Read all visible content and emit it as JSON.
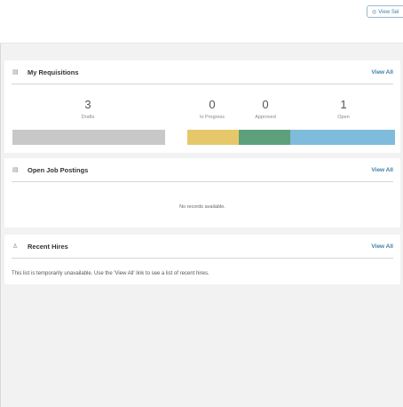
{
  "header": {
    "view_button_label": "View Sel",
    "view_button_icon": "eye-icon"
  },
  "requisitions": {
    "title": "My Requisitions",
    "icon": "document-icon",
    "view_all": "View All",
    "stats": [
      {
        "value": "3",
        "label": "Drafts"
      },
      {
        "value": "0",
        "label": "In Progress"
      },
      {
        "value": "0",
        "label": "Approved"
      },
      {
        "value": "1",
        "label": "Open"
      }
    ],
    "bar_colors": {
      "drafts": "#c8c8c8",
      "in_progress": "#e6c86a",
      "approved": "#5fa07c",
      "open": "#7fbcdc"
    }
  },
  "job_postings": {
    "title": "Open Job Postings",
    "icon": "document-icon",
    "view_all": "View All",
    "empty_message": "No records available."
  },
  "recent_hires": {
    "title": "Recent Hires",
    "icon": "person-icon",
    "view_all": "View All",
    "message": "This list is temporarily unavailable. Use the 'View All' link to see a list of recent hires."
  }
}
